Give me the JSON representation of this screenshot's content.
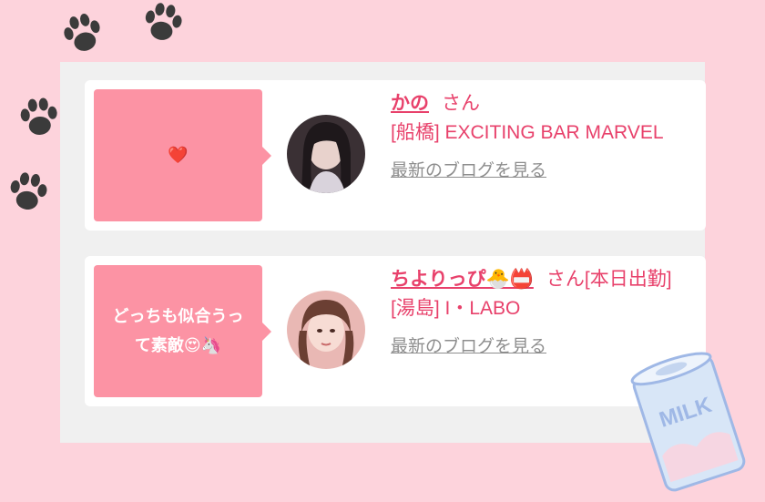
{
  "entries": [
    {
      "comment": "❤️",
      "name": "かの",
      "honorific": "さん",
      "shop": "[船橋] EXCITING BAR MARVEL",
      "blog_link": "最新のブログを見る"
    },
    {
      "comment": "どっちも似合うって素敵😍🦄",
      "name": "ちよりっぴ🐣📛",
      "honorific": "さん[本日出勤]",
      "shop": "[湯島] I・LABO",
      "blog_link": "最新のブログを見る"
    }
  ],
  "decorations": {
    "milk_label": "MILK",
    "paw_icon": "paw-icon",
    "colors": {
      "background": "#fdd3dc",
      "bubble": "#fc93a4",
      "accent": "#e8416b",
      "link_gray": "#8e8e8e"
    }
  }
}
